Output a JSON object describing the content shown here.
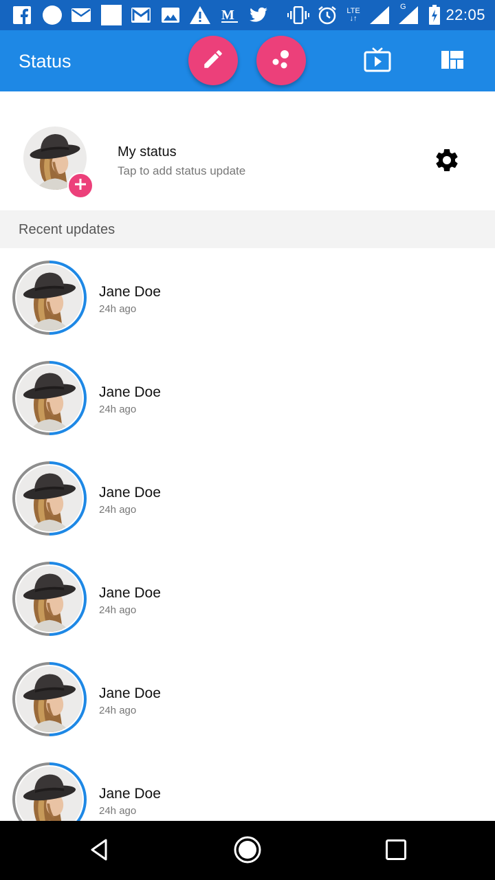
{
  "status_bar": {
    "time": "22:05",
    "network_label": "LTE",
    "signal_label": "G",
    "icons": [
      "facebook-icon",
      "circle-icon",
      "mail-icon",
      "square-icon",
      "gmail-icon",
      "image-icon",
      "warning-icon",
      "medium-icon",
      "twitter-icon",
      "vibrate-icon",
      "alarm-icon",
      "signal-icon",
      "battery-icon"
    ]
  },
  "app_bar": {
    "title": "Status",
    "actions": [
      "pencil-icon",
      "dots-icon",
      "tv-icon",
      "dashboard-icon"
    ],
    "accent_color": "#ec407a",
    "bar_color": "#1e88e5"
  },
  "my_status": {
    "title": "My status",
    "subtitle": "Tap to add status update"
  },
  "recent": {
    "header": "Recent updates",
    "items": [
      {
        "name": "Jane Doe",
        "time": "24h ago"
      },
      {
        "name": "Jane Doe",
        "time": "24h ago"
      },
      {
        "name": "Jane Doe",
        "time": "24h ago"
      },
      {
        "name": "Jane Doe",
        "time": "24h ago"
      },
      {
        "name": "Jane Doe",
        "time": "24h ago"
      },
      {
        "name": "Jane Doe",
        "time": "24h ago"
      }
    ]
  },
  "nav_bar": {
    "buttons": [
      "back-icon",
      "home-icon",
      "recents-icon"
    ]
  }
}
